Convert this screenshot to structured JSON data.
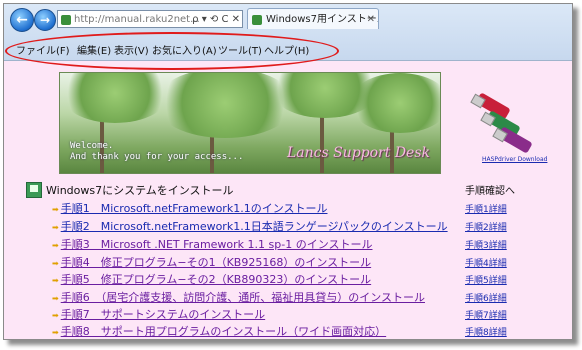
{
  "browser": {
    "url": "http://manual.raku2net...",
    "tab_title": "Windows7用インストール...",
    "back_glyph": "←",
    "forward_glyph": "→",
    "addr_icons": "ρ ▾ ⟲ C ✕",
    "tab_close": "✕"
  },
  "menu": {
    "items": [
      "ファイル(F)",
      "編集(E)",
      "表示(V)",
      "お気に入り(A)",
      "ツール(T)",
      "ヘルプ(H)"
    ]
  },
  "banner": {
    "welcome_line1": "Welcome.",
    "welcome_line2": "And thank you for your access...",
    "desk_text": "Lancs Support Desk"
  },
  "sidebar": {
    "hasp_link": "HASPdriver Download"
  },
  "section": {
    "title": "Windows7にシステムをインストール",
    "side_title": "手順確認へ"
  },
  "steps": [
    {
      "prefix": "手順1",
      "text": "手順1　Microsoft.netFramework1.1のインストール",
      "detail": "手順1詳細"
    },
    {
      "prefix": "手順2",
      "text": "手順2　Microsoft.netFramework1.1日本語ランゲージパックのインストール",
      "detail": "手順2詳細"
    },
    {
      "prefix": "手順3",
      "text": "手順3　Microsoft .NET Framework 1.1 sp-1 のインストール",
      "detail": "手順3詳細"
    },
    {
      "prefix": "手順4",
      "text": "手順4　修正プログラム−その1（KB925168）のインストール",
      "detail": "手順4詳細"
    },
    {
      "prefix": "手順5",
      "text": "手順5　修正プログラム−その2（KB890323）のインストール",
      "detail": "手順5詳細"
    },
    {
      "prefix": "手順6",
      "text": "手順6　（居宅介護支援、訪問介護、通所、福祉用具貸与）のインストール",
      "detail": "手順6詳細"
    },
    {
      "prefix": "手順7",
      "text": "手順7　サポートシステムのインストール",
      "detail": "手順7詳細"
    },
    {
      "prefix": "手順8",
      "text": "手順8　サポート用プログラムのインストール（ワイド画面対応）",
      "detail": "手順8詳細"
    }
  ],
  "colors": {
    "content_bg": "#fde6f7",
    "link": "#1a2bb0",
    "visited_link": "#6a1ea0",
    "highlight_ellipse": "#e01b1b"
  }
}
